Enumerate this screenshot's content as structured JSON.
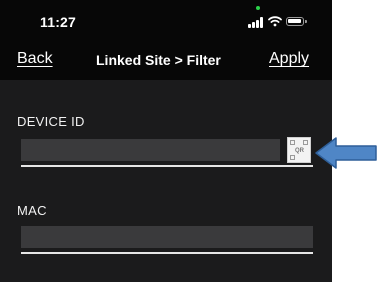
{
  "status_bar": {
    "time": "11:27",
    "icons": [
      "signal-icon",
      "wifi-icon",
      "battery-icon"
    ]
  },
  "nav": {
    "back_label": "Back",
    "title": "Linked Site > Filter",
    "apply_label": "Apply"
  },
  "form": {
    "device_id": {
      "label": "DEVICE ID",
      "value": "",
      "qr_label": "QR"
    },
    "mac": {
      "label": "MAC",
      "value": ""
    }
  },
  "colors": {
    "background": "#1b1b1c",
    "bar": "#070707",
    "input": "#3a3a3c",
    "annotation_arrow": "#4f86c6"
  }
}
